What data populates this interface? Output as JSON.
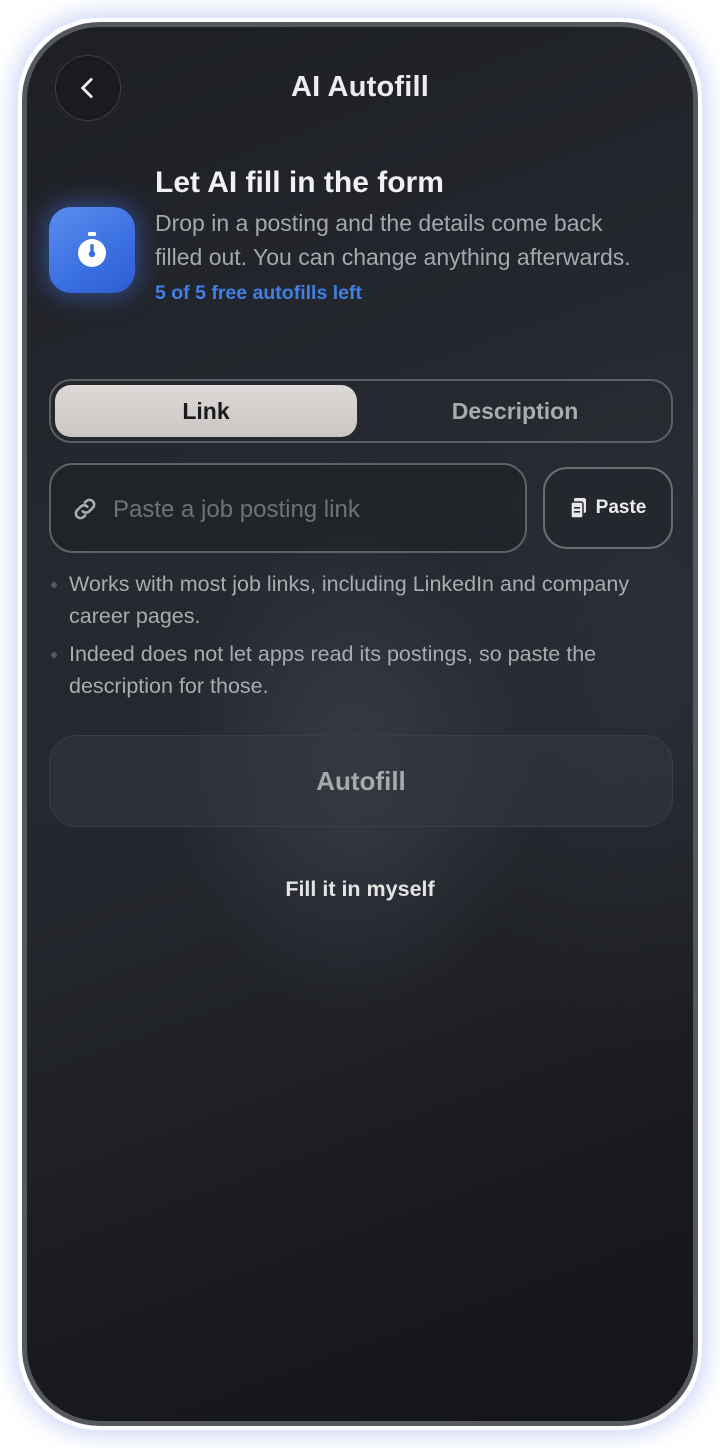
{
  "header": {
    "title": "AI Autofill",
    "back_icon": "chevron-left-icon"
  },
  "intro": {
    "icon": "stopwatch-icon",
    "title": "Let AI fill in the form",
    "description": "Drop in a posting and the details come back filled out. You can change anything afterwards.",
    "quota": "5 of 5 free autofills left"
  },
  "mode_tabs": {
    "items": [
      {
        "label": "Link",
        "selected": true
      },
      {
        "label": "Description",
        "selected": false
      }
    ]
  },
  "link_input": {
    "icon": "link-icon",
    "value": "",
    "placeholder": "Paste a job posting link"
  },
  "paste_button": {
    "icon": "clipboard-icon",
    "label": "Paste"
  },
  "notes": [
    "Works with most job links, including LinkedIn and company career pages.",
    "Indeed does not let apps read its postings, so paste the description for those."
  ],
  "autofill_button": {
    "label": "Autofill"
  },
  "manual_link": {
    "label": "Fill it in myself"
  },
  "colors": {
    "accent": "#3f7fe6",
    "background": "#24272d",
    "icon_tile": "#4a7fea"
  }
}
